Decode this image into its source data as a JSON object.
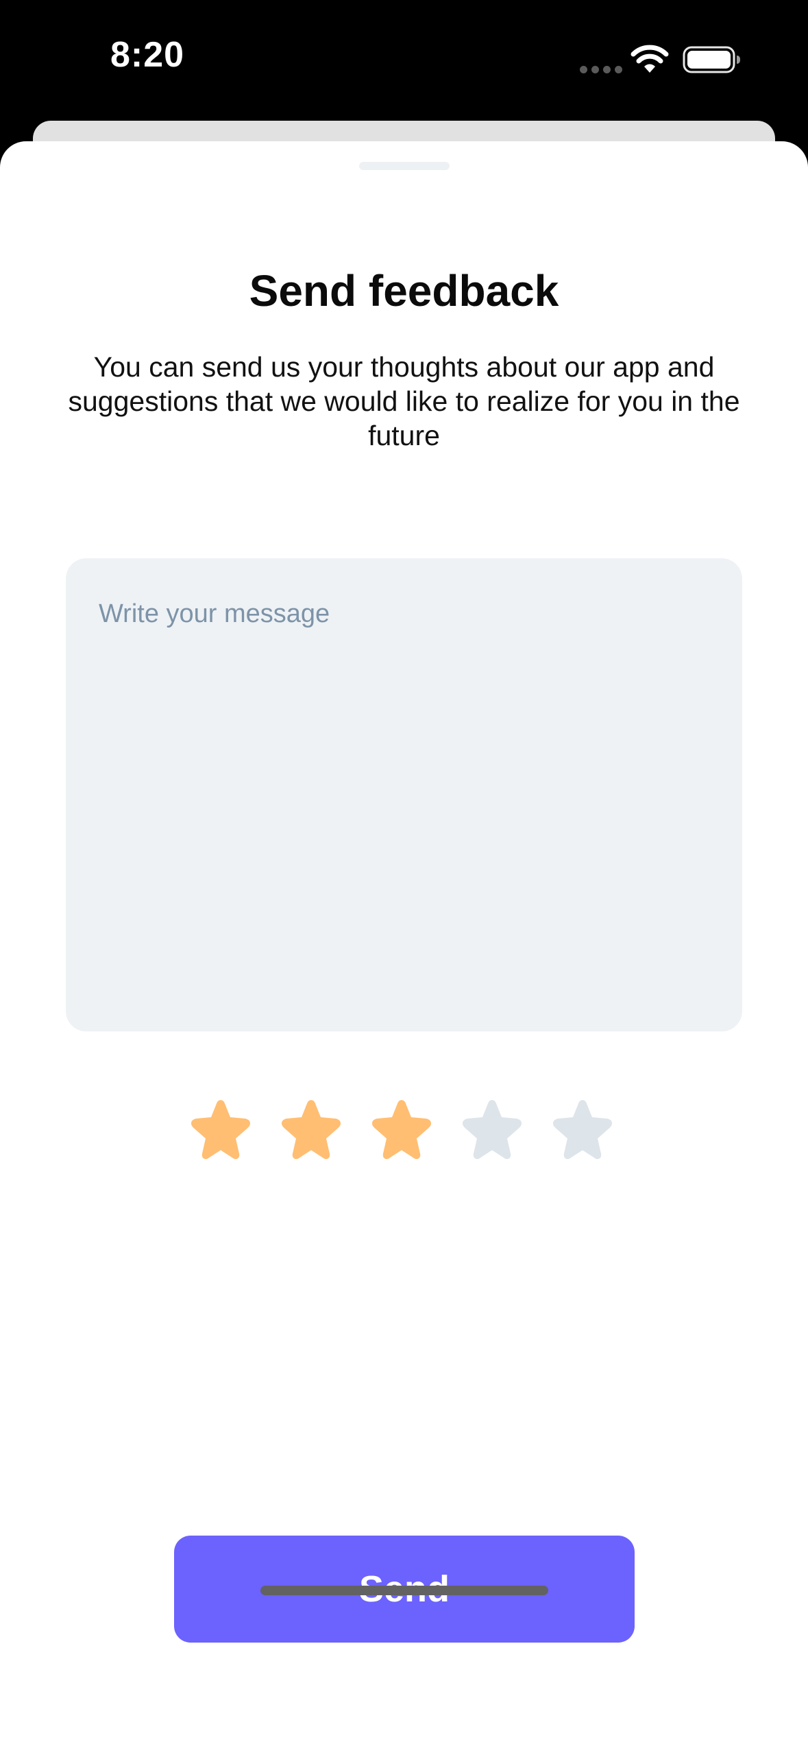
{
  "status_bar": {
    "time": "8:20"
  },
  "sheet": {
    "title": "Send feedback",
    "description": "You can send us your thoughts about our app and suggestions that we would like to realize for you in the future",
    "message": {
      "placeholder": "Write your message",
      "value": ""
    },
    "rating": {
      "value": 3,
      "max": 5,
      "filled_color": "#ffbe72",
      "empty_color": "#dde4ea"
    },
    "send_label": "Send"
  },
  "colors": {
    "accent": "#6c62fe"
  }
}
